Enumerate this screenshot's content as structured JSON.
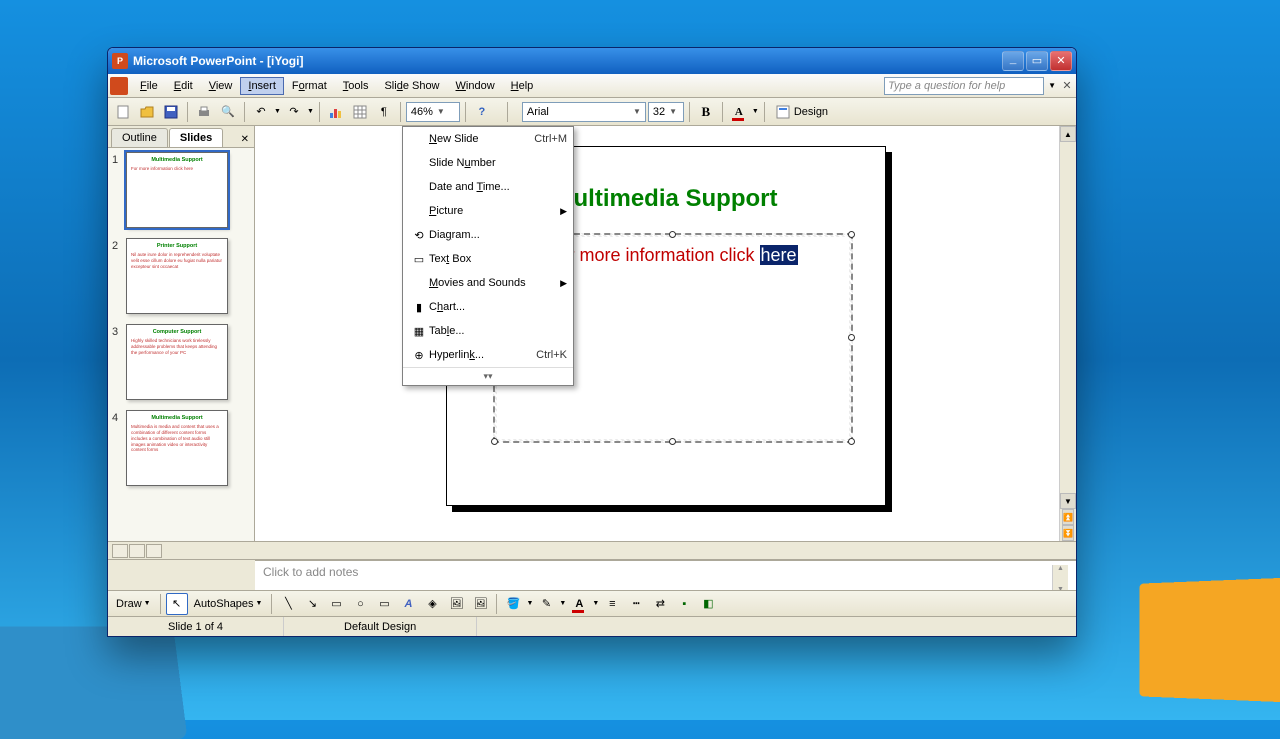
{
  "window": {
    "title": "Microsoft PowerPoint - [iYogi]"
  },
  "menubar": {
    "items": [
      "File",
      "Edit",
      "View",
      "Insert",
      "Format",
      "Tools",
      "Slide Show",
      "Window",
      "Help"
    ],
    "open_index": 3,
    "help_placeholder": "Type a question for help"
  },
  "toolbar": {
    "zoom": "46%",
    "font_name": "Arial",
    "font_size": "32",
    "design_label": "Design"
  },
  "insert_menu": [
    {
      "icon": "",
      "label": "New Slide",
      "shortcut": "Ctrl+M",
      "submenu": false,
      "ul": 0
    },
    {
      "icon": "",
      "label": "Slide Number",
      "shortcut": "",
      "submenu": false,
      "ul": 7
    },
    {
      "icon": "",
      "label": "Date and Time...",
      "shortcut": "",
      "submenu": false,
      "ul": 9
    },
    {
      "icon": "",
      "label": "Picture",
      "shortcut": "",
      "submenu": true,
      "ul": 0
    },
    {
      "icon": "⟲",
      "label": "Diagram...",
      "shortcut": "",
      "submenu": false,
      "ul": 3
    },
    {
      "icon": "▭",
      "label": "Text Box",
      "shortcut": "",
      "submenu": false,
      "ul": 3
    },
    {
      "icon": "",
      "label": "Movies and Sounds",
      "shortcut": "",
      "submenu": true,
      "ul": 0
    },
    {
      "icon": "▮",
      "label": "Chart...",
      "shortcut": "",
      "submenu": false,
      "ul": 1
    },
    {
      "icon": "▦",
      "label": "Table...",
      "shortcut": "",
      "submenu": false,
      "ul": 3
    },
    {
      "icon": "⊕",
      "label": "Hyperlink...",
      "shortcut": "Ctrl+K",
      "submenu": false,
      "ul": 8
    }
  ],
  "left_pane": {
    "tabs": [
      "Outline",
      "Slides"
    ],
    "active_tab": 1,
    "slides": [
      {
        "num": "1",
        "title": "Multimedia Support",
        "body": "For more information click here",
        "selected": true
      },
      {
        "num": "2",
        "title": "Printer Support",
        "body": "Nil aute irure dolor in reprehenderit voluptate velit esse cillum dolore eu fugiat nulla pariatur excepteur sint occaecat",
        "selected": false
      },
      {
        "num": "3",
        "title": "Computer Support",
        "body": "Highly skilled technicians work tirelessly addressable problems that keeps attending the performance of your PC",
        "selected": false
      },
      {
        "num": "4",
        "title": "Multimedia Support",
        "body": "Multimedia is media and content that uses a combination of different content forms includes a combination of text audio still images animation video or interactivity content forms",
        "selected": false
      }
    ]
  },
  "slide": {
    "title": "Multimedia Support",
    "text_prefix": "For more information click ",
    "text_selected": "here"
  },
  "notes": {
    "placeholder": "Click to add notes"
  },
  "draw_toolbar": {
    "draw_label": "Draw",
    "autoshapes_label": "AutoShapes"
  },
  "statusbar": {
    "slide_info": "Slide 1 of 4",
    "design": "Default Design"
  }
}
